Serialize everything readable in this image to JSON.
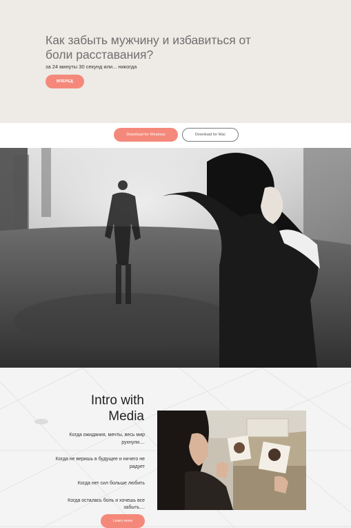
{
  "hero": {
    "title": "Как забыть мужчину и избавиться от боли расставания?",
    "subtitle": "за 24 минуты 30 секунд или... никогда",
    "button_label": "ВПЕРЕД"
  },
  "downloads": {
    "windows_label": "Download for Windows",
    "mac_label": "Download for Mac"
  },
  "intro": {
    "title": "Intro with Media",
    "items": [
      "Когда ожидания, мечты, весь мир рухнули....",
      "Когда не веришь в будущее и ничего не радует",
      "Когда нет сил больше любить",
      "Когда осталась боль и хочешь все забыть...."
    ],
    "button_label": "Learn more"
  },
  "colors": {
    "accent": "#f4897b",
    "hero_bg": "#eeeae6"
  }
}
